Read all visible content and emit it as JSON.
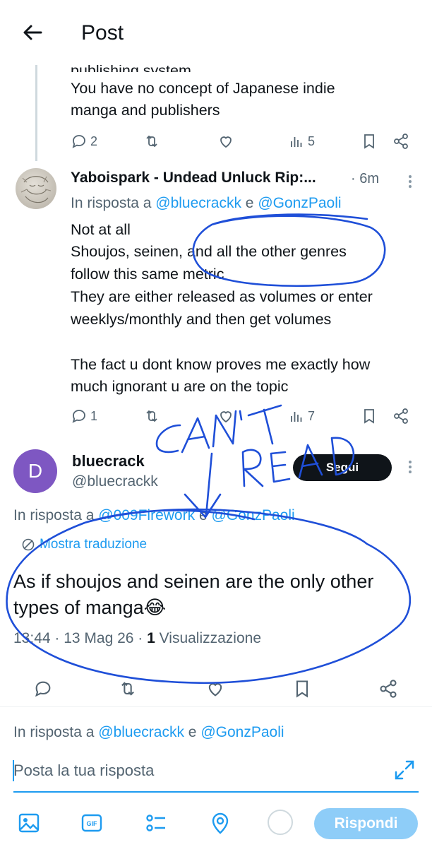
{
  "header": {
    "title": "Post"
  },
  "post1": {
    "lines": [
      "publishing system",
      "You have no concept of Japanese indie",
      "manga and publishers"
    ],
    "actions": {
      "replies": "2",
      "views": "5"
    }
  },
  "reply": {
    "name": "Yaboispark - Undead Unluck Rip:...",
    "time": "· 6m",
    "replying_prefix": "In risposta a",
    "mention1": "@bluecrackk",
    "conj": "e",
    "mention2": "@GonzPaoli",
    "lines": [
      "Not at all",
      "Shoujos, seinen, and all the other genres",
      "follow this same metric",
      "They are either released as volumes or enter",
      "weeklys/monthly and then get volumes",
      "The fact u dont know proves me exactly how",
      "much ignorant u are on the topic"
    ],
    "actions": {
      "replies": "1",
      "views": "7"
    }
  },
  "main": {
    "avatar_letter": "D",
    "name": "bluecrack",
    "handle": "@bluecrackk",
    "follow_label": "Segui",
    "replying_prefix": "In risposta a",
    "mention1": "@009Firework",
    "conj": "e",
    "mention2": "@GonzPaoli",
    "translate_label": "Mostra traduzione",
    "text_line1": "As if shoujos and seinen are the only other",
    "text_line2": "types of manga😂",
    "time": "13:44 · 13 Mag 26 · ",
    "views_count": "1",
    "views_label": " Visualizzazione"
  },
  "composer": {
    "replying_prefix": "In risposta a",
    "mention1": "@bluecrackk",
    "conj": "e",
    "mention2": "@GonzPaoli",
    "placeholder": "Posta la tua risposta",
    "reply_button": "Rispondi"
  },
  "annotation": {
    "text": "CAN'T READ"
  },
  "icons": {
    "back": "arrow-left-icon",
    "reply": "reply-icon",
    "repost": "repost-icon",
    "like": "heart-icon",
    "views": "bar-chart-icon",
    "bookmark": "bookmark-icon",
    "share": "share-icon",
    "translate": "globe-icon",
    "expand": "expand-icon",
    "image": "image-icon",
    "gif": "gif-icon",
    "poll": "poll-icon",
    "location": "location-icon"
  },
  "colors": {
    "accent": "#1d9bf0",
    "secondary_text": "#536471",
    "annotation_ink": "#1f4fd8",
    "avatar": "#7e57c2"
  }
}
